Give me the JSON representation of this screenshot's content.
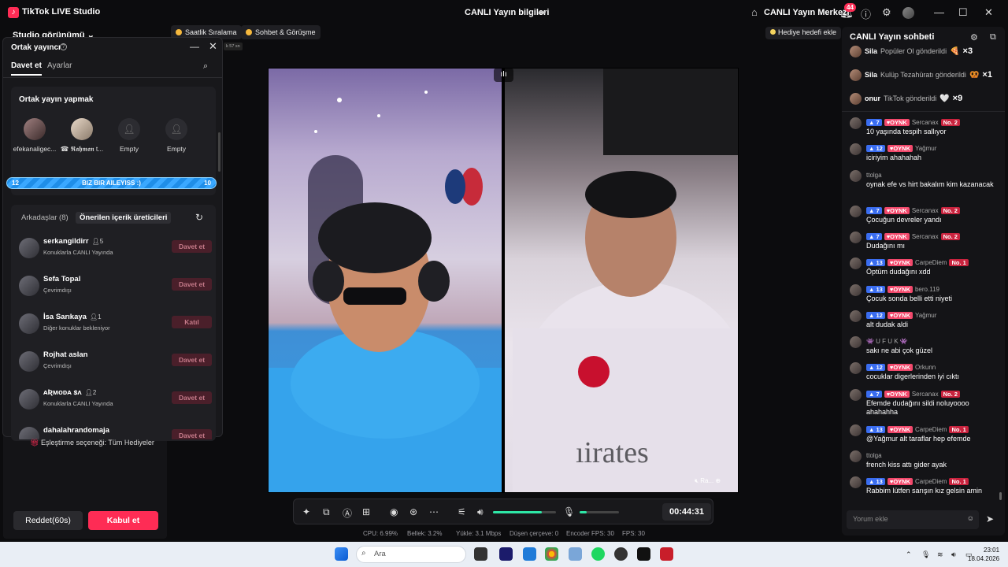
{
  "titlebar": {
    "app_title": "TikTok LIVE Studio",
    "center_title": "CANLI Yayın bilgileri",
    "live_center": "CANLI Yayın Merkezi",
    "notification_count": "44"
  },
  "topbar": {
    "studio_view": "Studio görünümü",
    "hourly_ranking": "Saatlik Sıralama",
    "chat_meeting": "Sohbet & Görüşme",
    "timer_chip": "k 57 sn",
    "gift_goal": "Hediye hedefi ekle"
  },
  "cohost_panel": {
    "title": "Ortak yayıncı",
    "tabs": [
      "Davet et",
      "Ayarlar"
    ],
    "section_title": "Ortak yayın yapmak",
    "slots": [
      {
        "name": "efekanaligec..."
      },
      {
        "name": "☎ 𝕽𝖆𝖍𝖒𝖆𝖓 t..."
      },
      {
        "name": "Empty"
      },
      {
        "name": "Empty"
      }
    ],
    "progress": {
      "left": "12",
      "label": "BIZ BIR AILEYISS :)",
      "right": "10"
    },
    "friends_tab": "Arkadaşlar (8)",
    "suggested_tab": "Önerilen içerik üreticileri",
    "friends": [
      {
        "name": "serkangildirr",
        "count": "5",
        "status": "Konuklarla CANLI Yayında",
        "button": "Davet et"
      },
      {
        "name": "Sefa Topal",
        "count": "",
        "status": "Çevrimdışı",
        "button": "Davet et"
      },
      {
        "name": "İsa Sarıkaya",
        "count": "1",
        "status": "Diğer konuklar bekleniyor",
        "button": "Katıl"
      },
      {
        "name": "Rojhat aslan",
        "count": "",
        "status": "Çevrimdışı",
        "button": "Davet et"
      },
      {
        "name": "ᴀƦᴍᴏᴅᴀ ꜱᴧ",
        "count": "2",
        "status": "Konuklarla CANLI Yayında",
        "button": "Davet et"
      },
      {
        "name": "dahalahrandomaja",
        "count": "",
        "status": "",
        "button": "Davet et"
      }
    ]
  },
  "matching": {
    "label": "Eşleştirme seçeneği: Tüm Hediyeler"
  },
  "actions": {
    "reject": "Reddet(60s)",
    "accept": "Kabul et"
  },
  "video": {
    "guest_label": "Ra..."
  },
  "controls": {
    "timer": "00:44:31",
    "volume_level": 0.78,
    "mic_level": 0.18
  },
  "stats": {
    "cpu": "CPU:  6.99%",
    "memory": "Bellek:  3.2%",
    "upload": "Yükle:  3.1 Mbps",
    "dropped": "Düşen çerçeve:  0",
    "encoder_fps": "Encoder FPS:  30",
    "fps": "FPS:  30"
  },
  "chat": {
    "title": "CANLI Yayın sohbeti",
    "gifts": [
      {
        "user": "Sila",
        "text": "Popüler Ol gönderildi",
        "icon": "🍕",
        "count": "×3"
      },
      {
        "user": "Sila",
        "text": "Kulüp Tezahüratı gönderildi",
        "icon": "🥨",
        "count": "×1"
      },
      {
        "user": "onur",
        "text": "TikTok gönderildi",
        "icon": "🤍",
        "count": "×9"
      }
    ],
    "messages": [
      {
        "level": "7",
        "club": "OYNK",
        "user": "Sercanax",
        "rank": "No. 2",
        "text": "10 yaşında tespih sallıyor"
      },
      {
        "level": "12",
        "club": "OYNK",
        "user": "Yağmur",
        "rank": "",
        "text": "iciriyim ahahahah"
      },
      {
        "level": "",
        "club": "",
        "user": "ttolga",
        "rank": "",
        "text": "oynak efe vs hirt bakalım kim kazanacak"
      },
      {
        "level": "7",
        "club": "OYNK",
        "user": "Sercanax",
        "rank": "No. 2",
        "text": "Çocuğun devreler yandı"
      },
      {
        "level": "7",
        "club": "OYNK",
        "user": "Sercanax",
        "rank": "No. 2",
        "text": "Dudağını mı"
      },
      {
        "level": "13",
        "club": "OYNK",
        "user": "CarpeDiem",
        "rank": "No. 1",
        "text": "Öptüm dudağını xdd"
      },
      {
        "level": "13",
        "club": "OYNK",
        "user": "bero.119",
        "rank": "",
        "text": "Çocuk sonda belli etti niyeti"
      },
      {
        "level": "12",
        "club": "OYNK",
        "user": "Yağmur",
        "rank": "",
        "text": "alt dudak aldi"
      },
      {
        "level": "",
        "club": "",
        "user": "👾 U F U K 👾",
        "rank": "",
        "text": "sakı ne abi çok güzel"
      },
      {
        "level": "12",
        "club": "OYNK",
        "user": "Orkunn",
        "rank": "",
        "text": "cocuklar digerlerinden iyi cıktı"
      },
      {
        "level": "7",
        "club": "OYNK",
        "user": "Sercanax",
        "rank": "No. 2",
        "text": "Efemde dudağını sildi noluyoooo ahahahha"
      },
      {
        "level": "13",
        "club": "OYNK",
        "user": "CarpeDiem",
        "rank": "No. 1",
        "text": "@Yağmur alt taraflar hep efemde"
      },
      {
        "level": "",
        "club": "",
        "user": "ttolga",
        "rank": "",
        "text": "french kiss attı gider ayak"
      },
      {
        "level": "13",
        "club": "OYNK",
        "user": "CarpeDiem",
        "rank": "No. 1",
        "text": "Rabbim lütfen sarışın kız gelsin amin"
      }
    ],
    "input_placeholder": "Yorum ekle"
  },
  "taskbar": {
    "search": "Ara",
    "time": "23:01",
    "date": "18.04.2026"
  }
}
